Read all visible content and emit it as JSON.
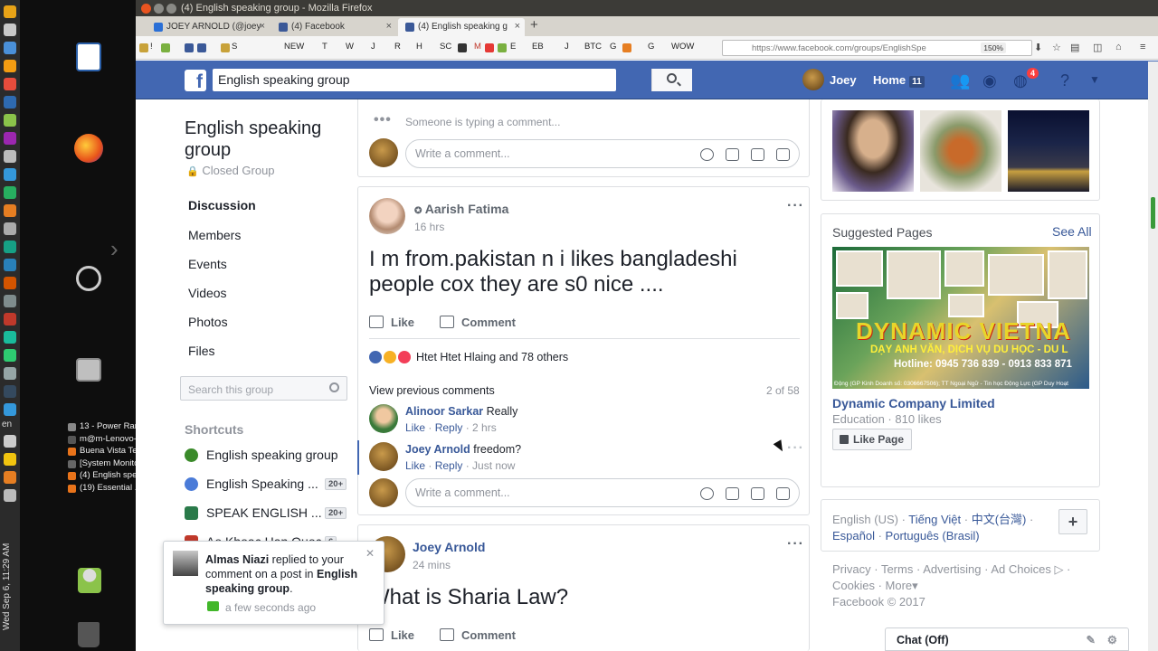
{
  "window": {
    "title": "(4) English speaking group - Mozilla Firefox"
  },
  "tabs": [
    {
      "label": "JOEY ARNOLD (@joey",
      "color": "#2a6fd6"
    },
    {
      "label": "(4) Facebook",
      "color": "#3b5998"
    },
    {
      "label": "(4) English speaking g",
      "color": "#3b5998",
      "active": true
    }
  ],
  "bookmarks": [
    "!",
    "S",
    "NEW",
    "T",
    "W",
    "J",
    "R",
    "H",
    "SC",
    "M",
    "E",
    "EB",
    "J",
    "BTC",
    "G",
    "G",
    "WOW"
  ],
  "url": "https://www.facebook.com/groups/EnglishSpe",
  "zoom": "150%",
  "fb": {
    "search_value": "English speaking group",
    "user": "Joey",
    "home_label": "Home",
    "home_count": "11",
    "notifications": "4"
  },
  "group": {
    "name": "English speaking group",
    "privacy": "Closed Group",
    "nav": [
      "Discussion",
      "Members",
      "Events",
      "Videos",
      "Photos",
      "Files"
    ],
    "search_placeholder": "Search this group",
    "shortcuts_title": "Shortcuts",
    "shortcuts": [
      {
        "label": "English speaking group",
        "badge": "",
        "color": "#3a8a2a"
      },
      {
        "label": "English Speaking ...",
        "badge": "20+",
        "color": "#4a7bd8"
      },
      {
        "label": "SPEAK ENGLISH ...",
        "badge": "20+",
        "color": "#2a7a4a"
      },
      {
        "label": "Ao Khoac Han Quoc",
        "badge": "6",
        "color": "#c0392b"
      }
    ]
  },
  "feed": {
    "typing": "Someone is typing a comment...",
    "write_comment": "Write a comment...",
    "post1": {
      "author": "Aarish Fatima",
      "time": "16 hrs",
      "text": "I m from.pakistan n i likes bangladeshi people cox they are s0 nice ....",
      "like": "Like",
      "comment": "Comment",
      "reactions": "Htet Htet Hlaing and 78 others",
      "view_prev": "View previous comments",
      "count": "2 of 58",
      "comments": [
        {
          "author": "Alinoor Sarkar",
          "text": "Really",
          "like": "Like",
          "reply": "Reply",
          "time": "2 hrs"
        },
        {
          "author": "Joey Arnold",
          "text": "freedom?",
          "like": "Like",
          "reply": "Reply",
          "time": "Just now"
        }
      ]
    },
    "post2": {
      "author": "Joey Arnold",
      "time": "24 mins",
      "text": "What is Sharia Law?",
      "like": "Like",
      "comment": "Comment"
    }
  },
  "right": {
    "suggested_title": "Suggested Pages",
    "see_all": "See All",
    "ad_line1": "DYNAMIC VIETNA",
    "ad_line2": "DẠY ANH VĂN, DỊCH VỤ DU HỌC - DU L",
    "ad_line3": "Hotline: 0945 736 839 - 0913 833 871",
    "ad_line4": "Động (GP Kinh Doanh số: 0306667506); TT Ngoại Ngữ - Tin học Động Lực (GP Duy Hoạt",
    "page_name": "Dynamic Company Limited",
    "page_meta": "Education · 810 likes",
    "like_page": "Like Page",
    "lang_current": "English (US)",
    "languages": [
      "Tiếng Việt",
      "中文(台灣)",
      "Español",
      "Português (Brasil)"
    ],
    "footer_links": [
      "Privacy",
      "Terms",
      "Advertising",
      "Ad Choices",
      "Cookies",
      "More"
    ],
    "copyright": "Facebook © 2017",
    "chat": "Chat (Off)"
  },
  "toast": {
    "name": "Almas Niazi",
    "middle": "replied to your comment on a post in",
    "group": "English speaking group",
    "end": ".",
    "time": "a few seconds ago"
  },
  "desktop": {
    "clock": "Wed Sep 6, 11:29 AM",
    "lang": "en",
    "windows": [
      {
        "label": "13 - Power Ran...",
        "color": "#888"
      },
      {
        "label": "m@m-Lenovo-...",
        "color": "#555"
      },
      {
        "label": "Buena Vista Te...",
        "color": "#e8731a"
      },
      {
        "label": "[System Monitor]",
        "color": "#666"
      },
      {
        "label": "(4) English spe...",
        "color": "#e8731a"
      },
      {
        "label": "(19) Essential ...",
        "color": "#e8731a"
      }
    ]
  }
}
